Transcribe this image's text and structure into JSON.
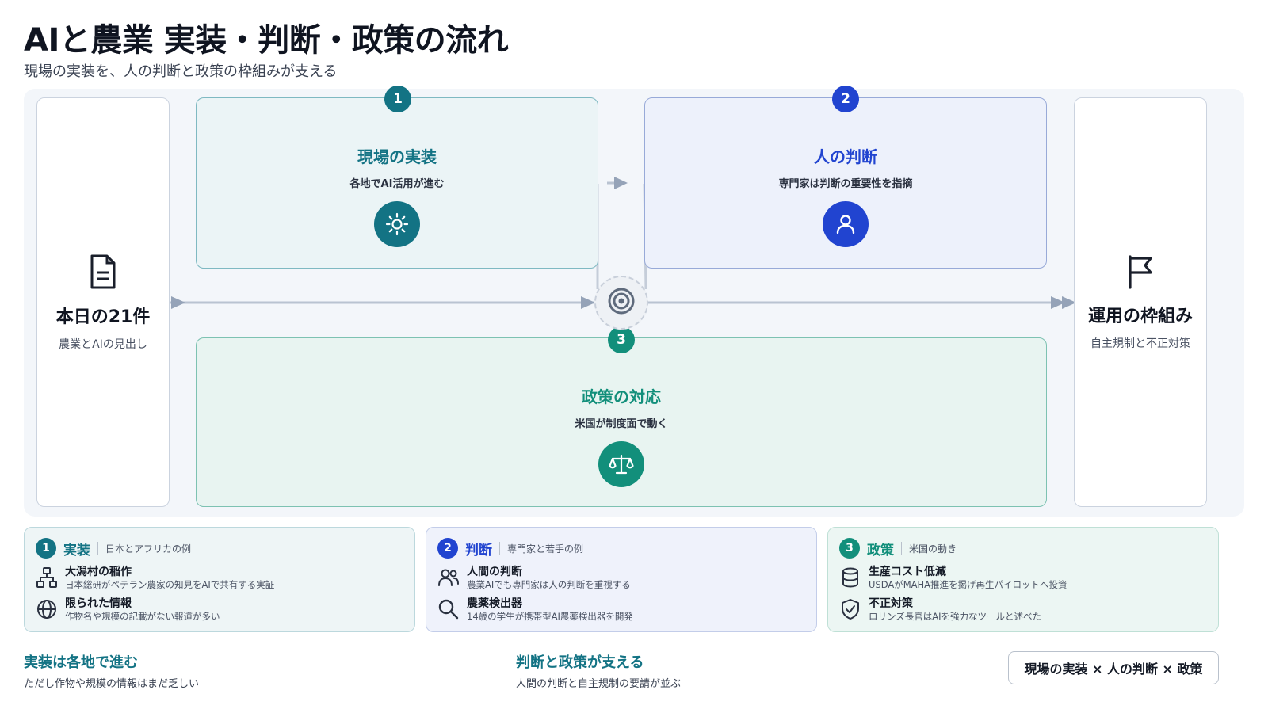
{
  "header": {
    "title": "AIと農業 実装・判断・政策の流れ",
    "subtitle": "現場の実装を、人の判断と政策の枠組みが支える"
  },
  "diagram": {
    "left_card": {
      "icon": "document-icon",
      "title": "本日の21件",
      "subtitle": "農業とAIの見出し"
    },
    "right_card": {
      "icon": "flag-icon",
      "title": "運用の枠組み",
      "subtitle": "自主規制と不正対策"
    },
    "hub": {
      "icon": "target-icon"
    },
    "blocks": [
      {
        "number": "1",
        "title": "現場の実装",
        "subtitle": "各地でAI活用が進む",
        "icon": "sun-icon",
        "color": "#137384"
      },
      {
        "number": "2",
        "title": "人の判断",
        "subtitle": "専門家は判断の重要性を指摘",
        "icon": "person-icon",
        "color": "#2144d0"
      },
      {
        "number": "3",
        "title": "政策の対応",
        "subtitle": "米国が制度面で動く",
        "icon": "scales-icon",
        "color": "#128f7b"
      }
    ]
  },
  "legend": [
    {
      "number": "1",
      "title": "実装",
      "subtitle": "日本とアフリカの例",
      "color": "#137384",
      "items": [
        {
          "icon": "network-icon",
          "heading": "大潟村の稲作",
          "desc": "日本総研がベテラン農家の知見をAIで共有する実証"
        },
        {
          "icon": "globe-icon",
          "heading": "限られた情報",
          "desc": "作物名や規模の記載がない報道が多い"
        }
      ]
    },
    {
      "number": "2",
      "title": "判断",
      "subtitle": "専門家と若手の例",
      "color": "#2144d0",
      "items": [
        {
          "icon": "people-icon",
          "heading": "人間の判断",
          "desc": "農業AIでも専門家は人の判断を重視する"
        },
        {
          "icon": "search-icon",
          "heading": "農薬検出器",
          "desc": "14歳の学生が携帯型AI農薬検出器を開発"
        }
      ]
    },
    {
      "number": "3",
      "title": "政策",
      "subtitle": "米国の動き",
      "color": "#128f7b",
      "items": [
        {
          "icon": "database-icon",
          "heading": "生産コスト低減",
          "desc": "USDAがMAHA推進を掲げ再生パイロットへ投資"
        },
        {
          "icon": "shield-check-icon",
          "heading": "不正対策",
          "desc": "ロリンズ長官はAIを強力なツールと述べた"
        }
      ]
    }
  ],
  "footer": {
    "left": {
      "heading": "実装は各地で進む",
      "desc": "ただし作物や規模の情報はまだ乏しい"
    },
    "center": {
      "heading": "判断と政策が支える",
      "desc": "人間の判断と自主規制の要請が並ぶ"
    },
    "pill": "現場の実装 × 人の判断 × 政策"
  }
}
